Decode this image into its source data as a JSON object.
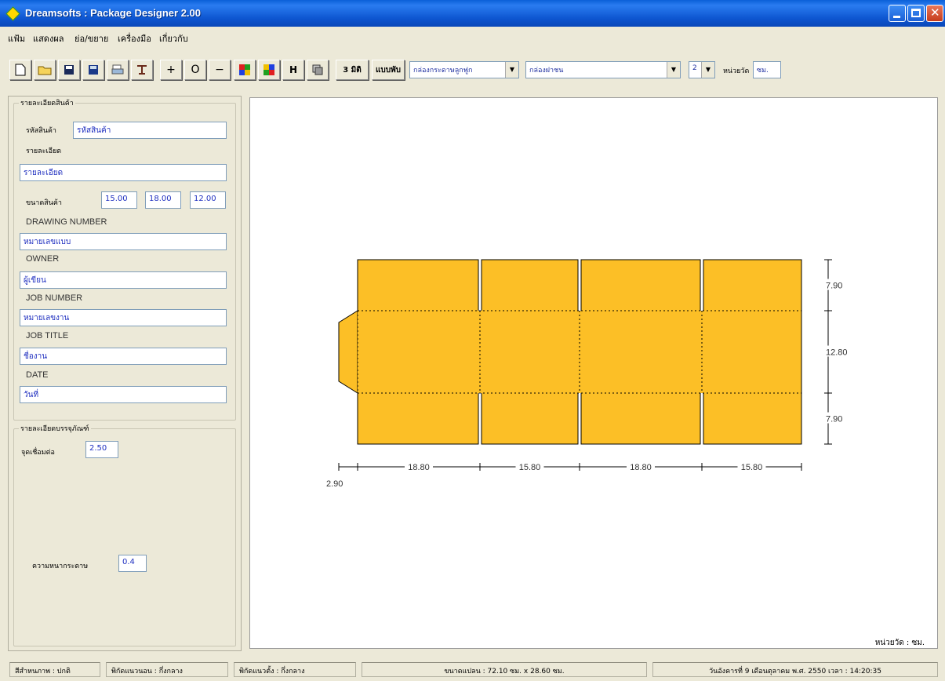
{
  "window": {
    "title": "Dreamsofts : Package Designer 2.00"
  },
  "menu": [
    "แฟ้ม",
    "แสดงผล",
    "ย่อ/ขยาย",
    "เครื่องมือ",
    "เกี่ยวกับ"
  ],
  "toolbar": {
    "btn_3d": "3 มิติ",
    "btn_fold": "แบบพับ",
    "h_label": "H",
    "plus": "+",
    "circle": "O",
    "minus": "−",
    "box_type": "กล่องกระดาษลูกฟูก",
    "box_style": "กล่องฝาชน",
    "count": "2",
    "unit_label": "หน่วยวัด",
    "unit_value": "ซม."
  },
  "product": {
    "group_title": "รายละเอียดสินค้า",
    "code_label": "รหัสสินค้า",
    "code_value": "รหัสสินค้า",
    "detail_label": "รายละเอียด",
    "detail_value": "รายละเอียด",
    "size_label": "ขนาดสินค้า",
    "size_values": [
      "15.00",
      "18.00",
      "12.00"
    ],
    "drawing_number_label": "DRAWING NUMBER",
    "drawing_number_value": "หมายเลขแบบ",
    "owner_label": "OWNER",
    "owner_value": "ผู้เขียน",
    "job_number_label": "JOB NUMBER",
    "job_number_value": "หมายเลขงาน",
    "job_title_label": "JOB TITLE",
    "job_title_value": "ชื่องาน",
    "date_label": "DATE",
    "date_value": "วันที่"
  },
  "package": {
    "group_title": "รายละเอียดบรรจุภัณฑ์",
    "joint_label": "จุดเชื่อมต่อ",
    "joint_value": "2.50",
    "thickness_label": "ความหนากระดาษ",
    "thickness_value": "0.4"
  },
  "drawing": {
    "fill_color": "#fcbf26",
    "dims_horizontal": [
      "18.80",
      "15.80",
      "18.80",
      "15.80"
    ],
    "glue_tab": "2.90",
    "dims_vertical": [
      "7.90",
      "12.80",
      "7.90"
    ],
    "unit_note": "หน่วยวัด : ซม."
  },
  "status": {
    "mode": "สีสำหนภาพ : ปกติ",
    "x_coord": "พิกัดแนวนอน : กึ่งกลาง",
    "y_coord": "พิกัดแนวตั้ง : กึ่งกลาง",
    "sheet_size": "ขนาดแปลน : 72.10 ซม. x 28.60 ซม.",
    "datetime": "วันอังคารที่ 9 เดือนตุลาคม พ.ศ. 2550 เวลา : 14:20:35"
  }
}
